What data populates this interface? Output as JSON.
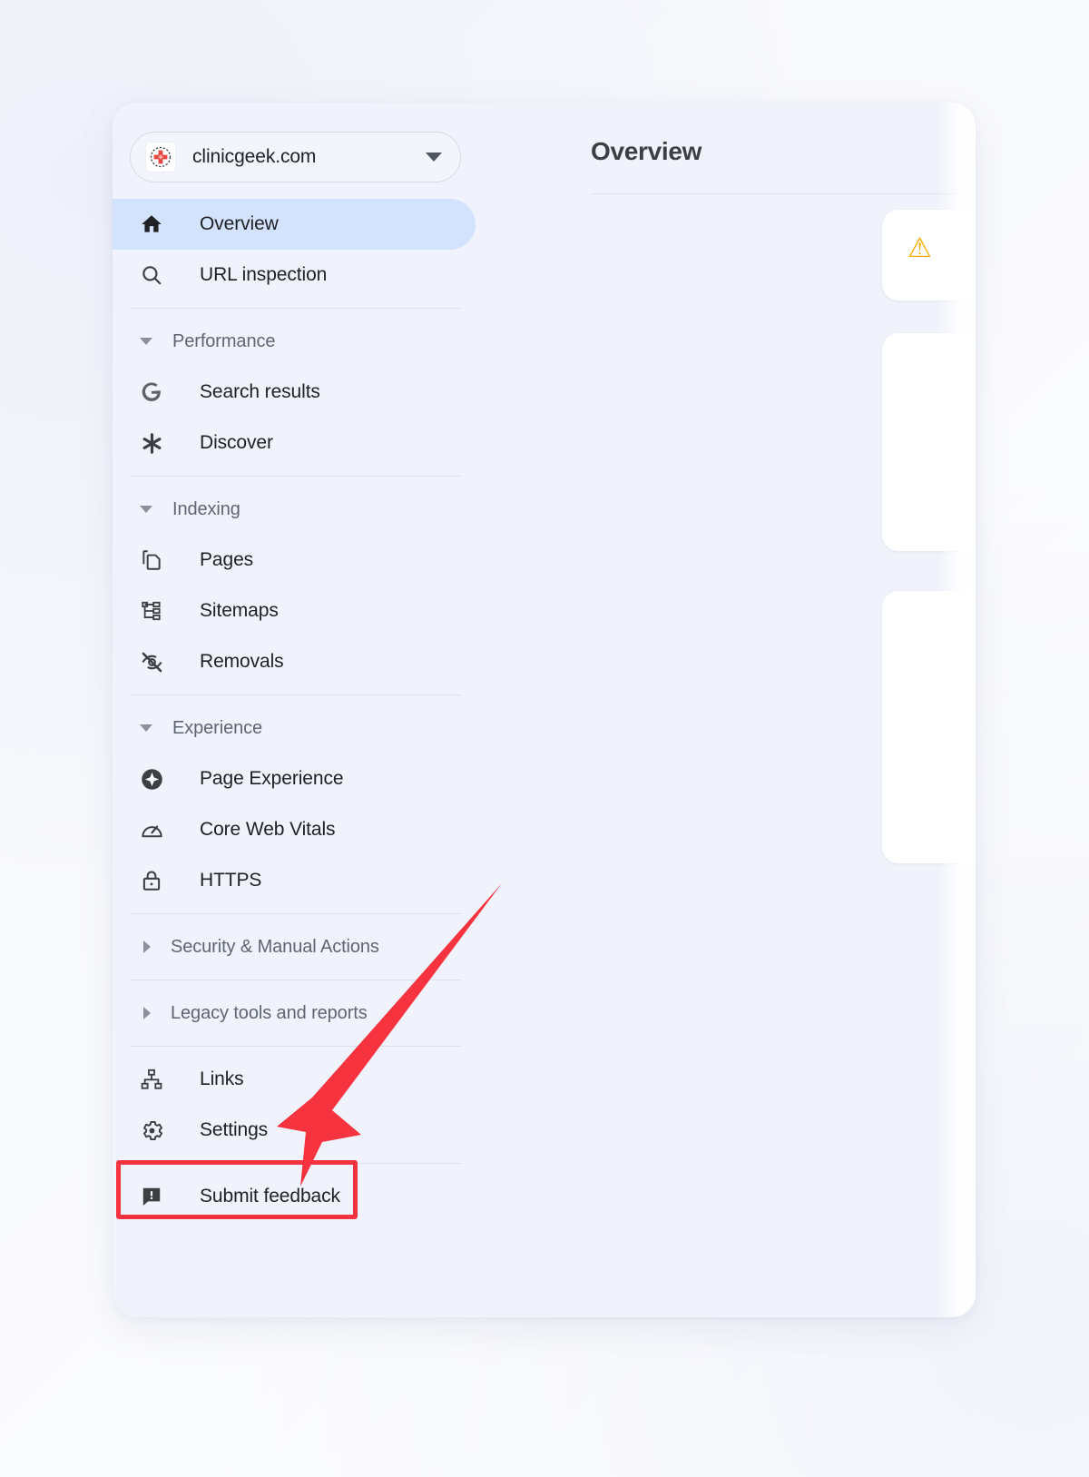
{
  "window": {
    "property_selector": {
      "label": "clinicgeek.com",
      "favicon_name": "medical-cross-favicon",
      "dropdown_icon": "chevron-down-icon"
    },
    "nav": {
      "top_items": [
        {
          "label": "Overview",
          "icon": "home-icon",
          "selected": true
        },
        {
          "label": "URL inspection",
          "icon": "search-icon",
          "selected": false
        }
      ],
      "sections": [
        {
          "label": "Performance",
          "expanded": true,
          "items": [
            {
              "label": "Search results",
              "icon": "google-g-icon"
            },
            {
              "label": "Discover",
              "icon": "discover-asterisk-icon"
            }
          ]
        },
        {
          "label": "Indexing",
          "expanded": true,
          "items": [
            {
              "label": "Pages",
              "icon": "pages-copy-icon"
            },
            {
              "label": "Sitemaps",
              "icon": "sitemap-tree-icon"
            },
            {
              "label": "Removals",
              "icon": "eye-off-icon"
            }
          ]
        },
        {
          "label": "Experience",
          "expanded": true,
          "items": [
            {
              "label": "Page Experience",
              "icon": "page-experience-icon"
            },
            {
              "label": "Core Web Vitals",
              "icon": "speedometer-icon"
            },
            {
              "label": "HTTPS",
              "icon": "lock-icon"
            }
          ]
        },
        {
          "label": "Security & Manual Actions",
          "expanded": false,
          "items": []
        },
        {
          "label": "Legacy tools and reports",
          "expanded": false,
          "items": []
        }
      ],
      "bottom_items": [
        {
          "label": "Links",
          "icon": "links-tree-icon"
        },
        {
          "label": "Settings",
          "icon": "gear-icon"
        }
      ],
      "footer_items": [
        {
          "label": "Submit feedback",
          "icon": "feedback-icon"
        }
      ]
    },
    "content": {
      "title": "Overview",
      "warning_icon": "warning-amber-icon"
    }
  },
  "annotation": {
    "highlight_target": "Settings",
    "highlight_color": "#f6333f",
    "arrow_color": "#f6333f",
    "arrow_points_to": "Settings"
  }
}
